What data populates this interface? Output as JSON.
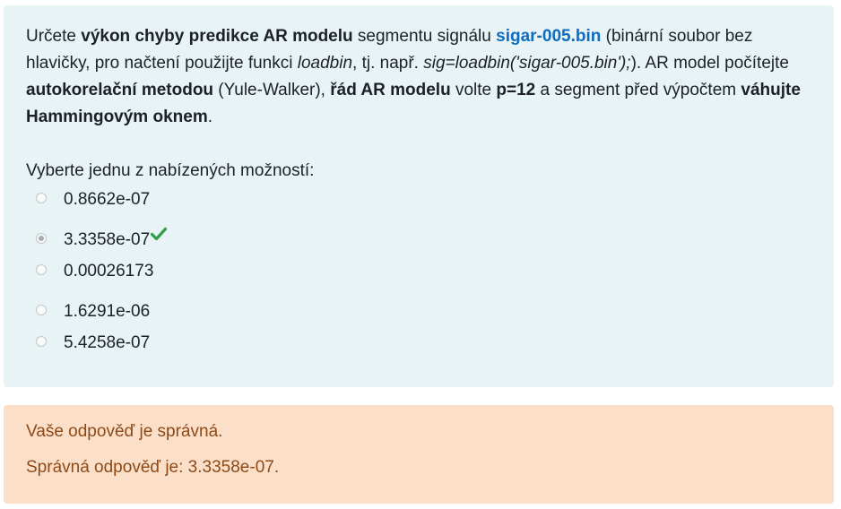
{
  "question": {
    "t1": "Určete ",
    "b1": "výkon chyby predikce AR modelu",
    "t2": " segmentu signálu ",
    "file": "sigar-005.bin",
    "t3": " (binární soubor bez hlavičky, pro načtení použijte funkci ",
    "i1": "loadbin",
    "t4": ", tj. např. ",
    "i2": "sig=loadbin('sigar-005.bin');",
    "t5": "). AR model počítejte ",
    "b2": "autokorelační metodou",
    "t6": " (Yule-Walker), ",
    "b3": "řád AR modelu",
    "t7": " volte ",
    "b4": "p=12",
    "t8": " a segment před výpočtem ",
    "b5": "váhujte Hammingovým oknem",
    "t9": "."
  },
  "prompt": "Vyberte jednu z nabízených možností:",
  "answers": [
    {
      "label": "0.8662e-07",
      "selected": false
    },
    {
      "label": "3.3358e-07",
      "selected": true,
      "correct": true
    },
    {
      "label": "0.00026173",
      "selected": false
    },
    {
      "label": "1.6291e-06",
      "selected": false
    },
    {
      "label": "5.4258e-07",
      "selected": false
    }
  ],
  "feedback": {
    "result": "Vaše odpověď je správná.",
    "correct_answer": "Správná odpověď je: 3.3358e-07."
  },
  "colors": {
    "question_bg": "#e7f3f5",
    "feedback_bg": "#fcdfc9",
    "feedback_text": "#8e4a16",
    "link": "#0f6cbf",
    "check": "#2e9e49"
  }
}
